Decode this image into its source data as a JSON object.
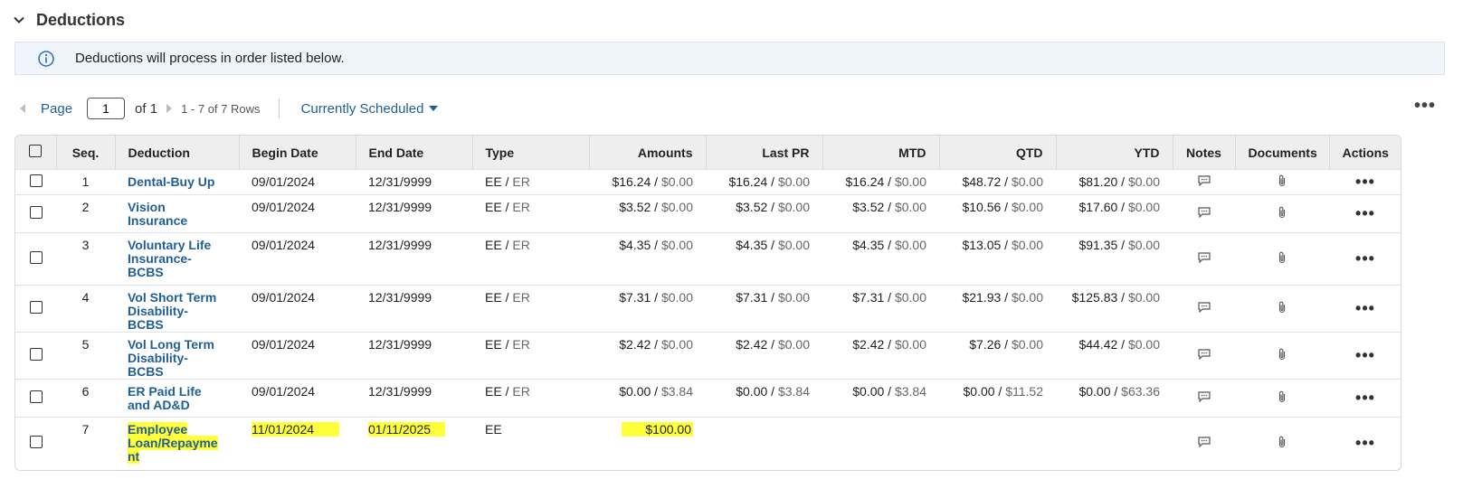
{
  "section": {
    "title": "Deductions",
    "icon": "chevron-down-icon"
  },
  "banner": {
    "text": "Deductions will process in order listed below.",
    "icon": "info-icon"
  },
  "pager": {
    "page_label": "Page",
    "page_value": "1",
    "of_label": "of 1",
    "rows_label": "1 - 7 of 7 Rows",
    "filter_label": "Currently Scheduled"
  },
  "more_icon": "more-horizontal-icon",
  "columns": {
    "seq": "Seq.",
    "deduction": "Deduction",
    "begin": "Begin Date",
    "end": "End Date",
    "type": "Type",
    "amounts": "Amounts",
    "last_pr": "Last PR",
    "mtd": "MTD",
    "qtd": "QTD",
    "ytd": "YTD",
    "notes": "Notes",
    "documents": "Documents",
    "actions": "Actions"
  },
  "colors": {
    "link": "#1f5f96",
    "highlight": "#ffff3a",
    "header_bg": "#eeeeee",
    "banner_bg": "#f0f4fb"
  },
  "rows": [
    {
      "seq": "1",
      "deduction": "Dental-Buy Up",
      "begin": "09/01/2024",
      "end": "12/31/9999",
      "type_ee": "EE",
      "type_er": "ER",
      "amounts_ee": "$16.24",
      "amounts_er": "$0.00",
      "lastpr_ee": "$16.24",
      "lastpr_er": "$0.00",
      "mtd_ee": "$16.24",
      "mtd_er": "$0.00",
      "qtd_ee": "$48.72",
      "qtd_er": "$0.00",
      "ytd_ee": "$81.20",
      "ytd_er": "$0.00"
    },
    {
      "seq": "2",
      "deduction": "Vision Insurance",
      "begin": "09/01/2024",
      "end": "12/31/9999",
      "type_ee": "EE",
      "type_er": "ER",
      "amounts_ee": "$3.52",
      "amounts_er": "$0.00",
      "lastpr_ee": "$3.52",
      "lastpr_er": "$0.00",
      "mtd_ee": "$3.52",
      "mtd_er": "$0.00",
      "qtd_ee": "$10.56",
      "qtd_er": "$0.00",
      "ytd_ee": "$17.60",
      "ytd_er": "$0.00"
    },
    {
      "seq": "3",
      "deduction": "Voluntary Life Insurance-BCBS",
      "begin": "09/01/2024",
      "end": "12/31/9999",
      "type_ee": "EE",
      "type_er": "ER",
      "amounts_ee": "$4.35",
      "amounts_er": "$0.00",
      "lastpr_ee": "$4.35",
      "lastpr_er": "$0.00",
      "mtd_ee": "$4.35",
      "mtd_er": "$0.00",
      "qtd_ee": "$13.05",
      "qtd_er": "$0.00",
      "ytd_ee": "$91.35",
      "ytd_er": "$0.00"
    },
    {
      "seq": "4",
      "deduction": "Vol Short Term Disability- BCBS",
      "begin": "09/01/2024",
      "end": "12/31/9999",
      "type_ee": "EE",
      "type_er": "ER",
      "amounts_ee": "$7.31",
      "amounts_er": "$0.00",
      "lastpr_ee": "$7.31",
      "lastpr_er": "$0.00",
      "mtd_ee": "$7.31",
      "mtd_er": "$0.00",
      "qtd_ee": "$21.93",
      "qtd_er": "$0.00",
      "ytd_ee": "$125.83",
      "ytd_er": "$0.00"
    },
    {
      "seq": "5",
      "deduction": "Vol Long Term Disability- BCBS",
      "begin": "09/01/2024",
      "end": "12/31/9999",
      "type_ee": "EE",
      "type_er": "ER",
      "amounts_ee": "$2.42",
      "amounts_er": "$0.00",
      "lastpr_ee": "$2.42",
      "lastpr_er": "$0.00",
      "mtd_ee": "$2.42",
      "mtd_er": "$0.00",
      "qtd_ee": "$7.26",
      "qtd_er": "$0.00",
      "ytd_ee": "$44.42",
      "ytd_er": "$0.00"
    },
    {
      "seq": "6",
      "deduction": "ER Paid Life and AD&D",
      "begin": "09/01/2024",
      "end": "12/31/9999",
      "type_ee": "EE",
      "type_er": "ER",
      "amounts_ee": "$0.00",
      "amounts_er": "$3.84",
      "lastpr_ee": "$0.00",
      "lastpr_er": "$3.84",
      "mtd_ee": "$0.00",
      "mtd_er": "$3.84",
      "qtd_ee": "$0.00",
      "qtd_er": "$11.52",
      "ytd_ee": "$0.00",
      "ytd_er": "$63.36"
    },
    {
      "seq": "7",
      "deduction": "Employee Loan/Repayment",
      "begin": "11/01/2024",
      "end": "01/11/2025",
      "type_ee": "EE",
      "amounts_ee": "$100.00"
    }
  ]
}
